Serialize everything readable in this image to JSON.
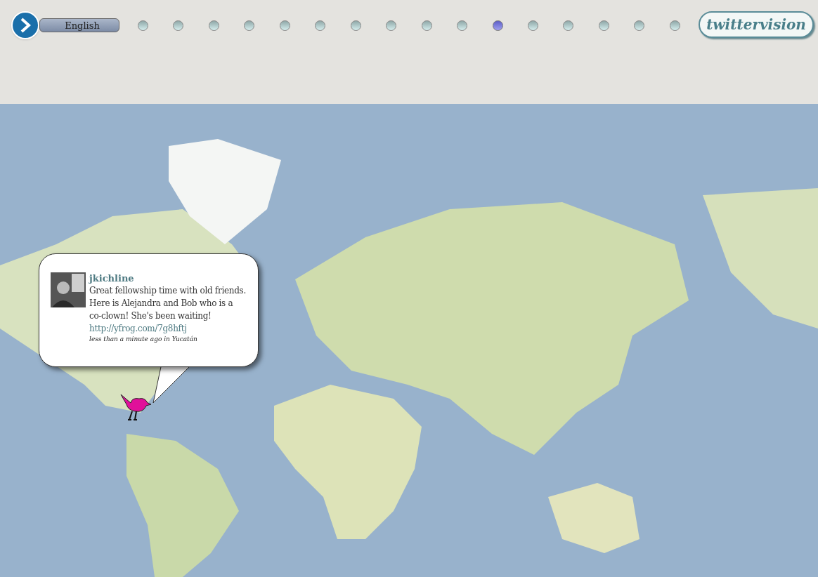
{
  "language": {
    "label": "English"
  },
  "dots": [
    {
      "selected": false
    },
    {
      "selected": false
    },
    {
      "selected": false
    },
    {
      "selected": false
    },
    {
      "selected": false
    },
    {
      "selected": false
    },
    {
      "selected": false
    },
    {
      "selected": false
    },
    {
      "selected": false
    },
    {
      "selected": false
    },
    {
      "selected": true
    },
    {
      "selected": false
    },
    {
      "selected": false
    },
    {
      "selected": false
    },
    {
      "selected": false
    },
    {
      "selected": false
    }
  ],
  "logo": "twittervision",
  "tweet": {
    "user": "jkichline",
    "text": "Great fellowship time with old friends. Here is Alejandra and Bob who is a co-clown! She's been waiting!",
    "link": "http://yfrog.com/7g8hftj",
    "meta": "less than a minute ago in Yucatán"
  }
}
